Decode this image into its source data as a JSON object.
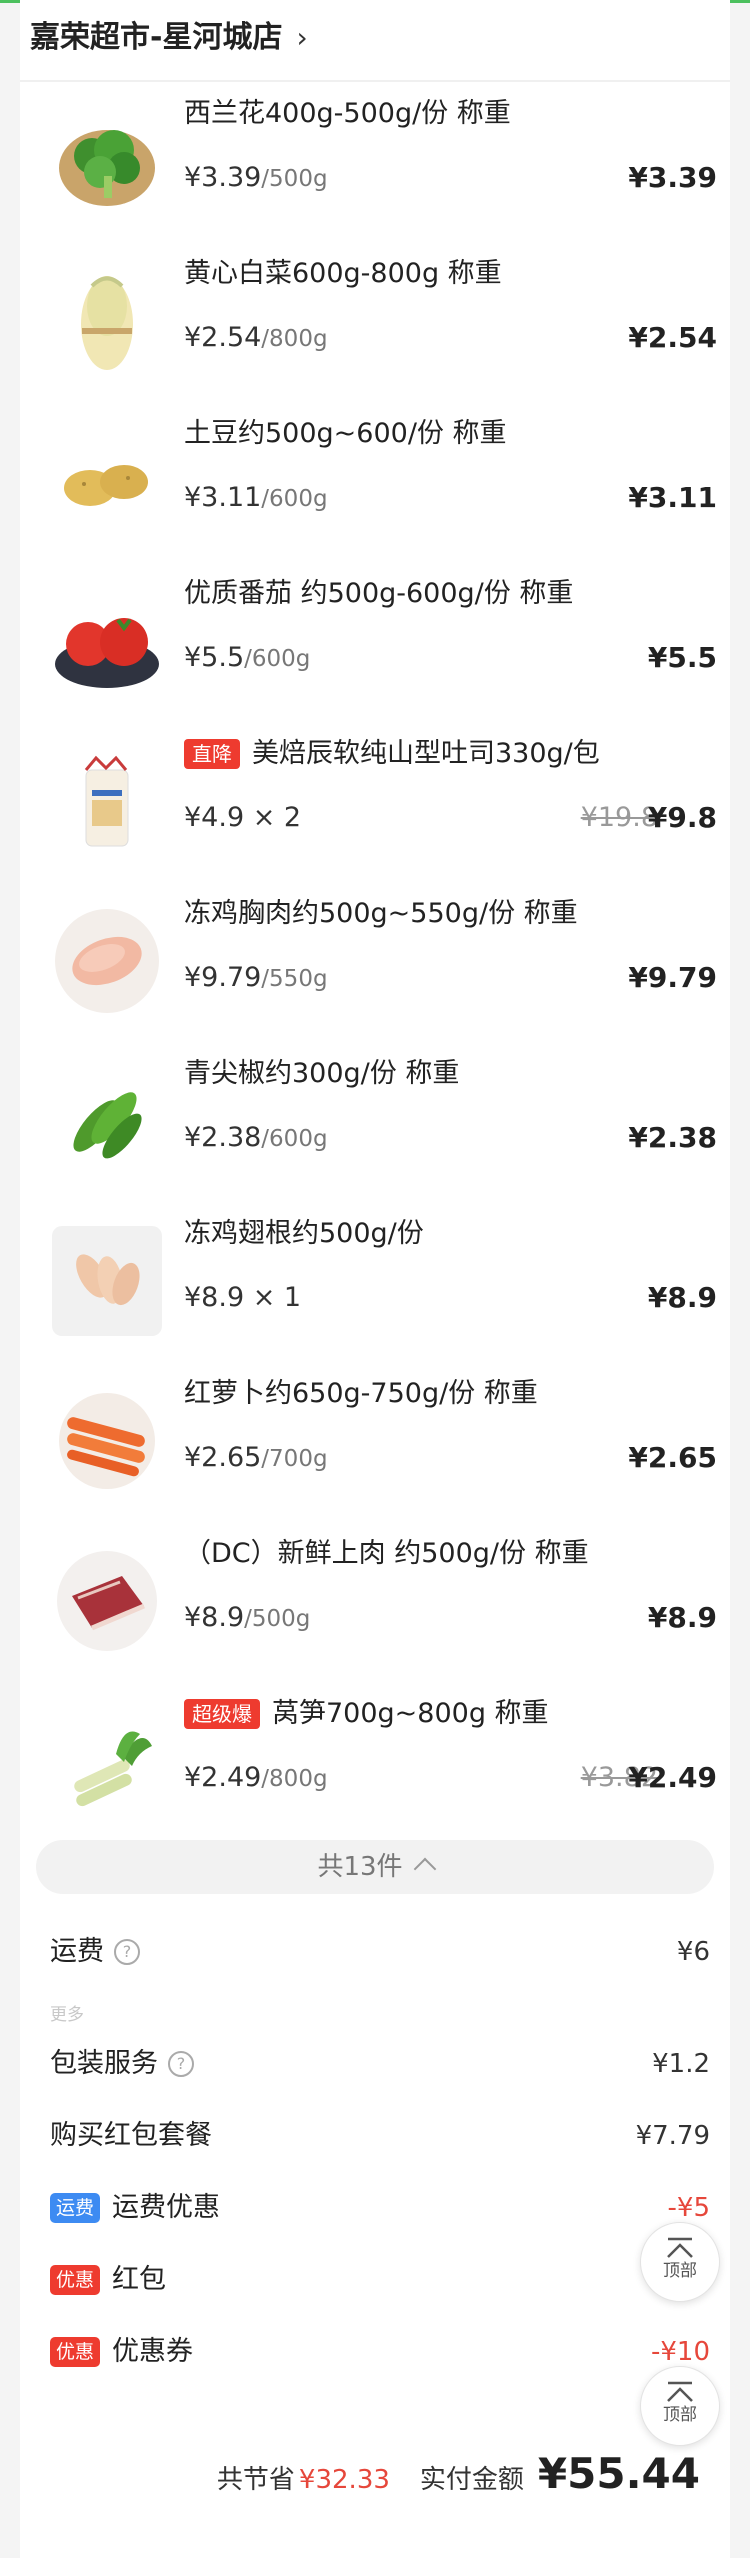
{
  "store": {
    "name": "嘉荣超市-星河城店",
    "chevron": "›"
  },
  "items": [
    {
      "title": "西兰花400g-500g/份 称重",
      "tag": "",
      "unit_price": "¥3.39",
      "unit_weight": "/500g",
      "orig": "",
      "total": "¥3.39",
      "icon": "broccoli-image"
    },
    {
      "title": "黄心白菜600g-800g 称重",
      "tag": "",
      "unit_price": "¥2.54",
      "unit_weight": "/800g",
      "orig": "",
      "total": "¥2.54",
      "icon": "cabbage-image"
    },
    {
      "title": "土豆约500g~600/份 称重",
      "tag": "",
      "unit_price": "¥3.11",
      "unit_weight": "/600g",
      "orig": "",
      "total": "¥3.11",
      "icon": "potato-image"
    },
    {
      "title": "优质番茄 约500g-600g/份 称重",
      "tag": "",
      "unit_price": "¥5.5",
      "unit_weight": "/600g",
      "orig": "",
      "total": "¥5.5",
      "icon": "tomato-image"
    },
    {
      "title": "美焙辰软纯山型吐司330g/包",
      "tag": "直降",
      "unit_price": "¥4.9 × 2",
      "unit_weight": "",
      "orig": "¥19.8",
      "total": "¥9.8",
      "icon": "toast-bread-image"
    },
    {
      "title": "冻鸡胸肉约500g~550g/份 称重",
      "tag": "",
      "unit_price": "¥9.79",
      "unit_weight": "/550g",
      "orig": "",
      "total": "¥9.79",
      "icon": "chicken-breast-image"
    },
    {
      "title": "青尖椒约300g/份 称重",
      "tag": "",
      "unit_price": "¥2.38",
      "unit_weight": "/600g",
      "orig": "",
      "total": "¥2.38",
      "icon": "green-pepper-image"
    },
    {
      "title": "冻鸡翅根约500g/份",
      "tag": "",
      "unit_price": "¥8.9 × 1",
      "unit_weight": "",
      "orig": "",
      "total": "¥8.9",
      "icon": "chicken-drumette-image"
    },
    {
      "title": "红萝卜约650g-750g/份 称重",
      "tag": "",
      "unit_price": "¥2.65",
      "unit_weight": "/700g",
      "orig": "",
      "total": "¥2.65",
      "icon": "carrot-image"
    },
    {
      "title": "（DC）新鲜上肉 约500g/份 称重",
      "tag": "",
      "unit_price": "¥8.9",
      "unit_weight": "/500g",
      "orig": "",
      "total": "¥8.9",
      "icon": "pork-image"
    },
    {
      "title": "莴笋700g~800g 称重",
      "tag": "超级爆",
      "unit_price": "¥2.49",
      "unit_weight": "/800g",
      "orig": "¥3.82",
      "total": "¥2.49",
      "icon": "lettuce-stem-image"
    }
  ],
  "collapse": {
    "label": "共13件"
  },
  "more_label": "更多",
  "fees": {
    "shipping": {
      "label": "运费",
      "value": "¥6"
    },
    "packing": {
      "label": "包装服务",
      "value": "¥1.2"
    },
    "redpack_set": {
      "label": "购买红包套餐",
      "value": "¥7.79"
    },
    "shipping_discount": {
      "badge": "运费",
      "label": "运费优惠",
      "value": "-¥5",
      "badge_color": "#3d8bf2"
    },
    "redpack": {
      "badge": "优惠",
      "label": "红包",
      "value": "",
      "badge_color": "#ee3b2f"
    },
    "coupon": {
      "badge": "优惠",
      "label": "优惠券",
      "value": "-¥10",
      "badge_color": "#ee3b2f"
    }
  },
  "float_buttons": {
    "top_label": "顶部"
  },
  "summary": {
    "save_label": "共节省",
    "save_value": "¥32.33",
    "pay_label": "实付金额",
    "pay_value": "¥55.44"
  },
  "colors": {
    "accent_red": "#e6473b",
    "brand_green": "#4cc05e",
    "badge_blue": "#3d8bf2"
  }
}
